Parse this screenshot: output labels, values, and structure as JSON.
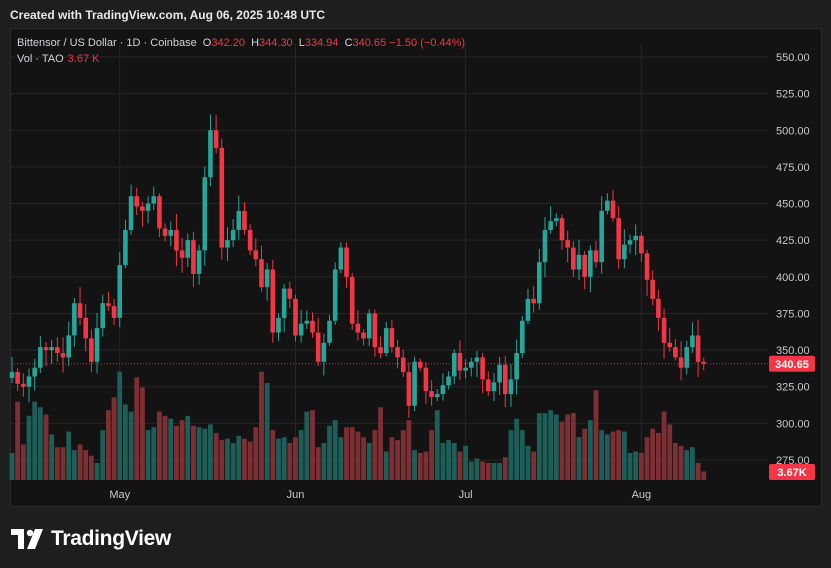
{
  "header": {
    "created_text": "Created with TradingView.com, Aug 06, 2025 10:48 UTC"
  },
  "legend": {
    "symbol": "Bittensor / US Dollar · 1D · Coinbase",
    "open_label": "O",
    "open": "342.20",
    "high_label": "H",
    "high": "344.30",
    "low_label": "L",
    "low": "334.94",
    "close_label": "C",
    "close": "340.65",
    "change": "−1.50 (−0.44%)",
    "volume_label": "Vol · TAO",
    "volume": "3.67 K"
  },
  "price_tag": "340.65",
  "volume_tag": "3.67K",
  "footer": {
    "brand": "TradingView"
  },
  "colors": {
    "up": "#26a69a",
    "down": "#f23645",
    "vol_up": "#1d5f58",
    "vol_down": "#7e2f33",
    "grid": "#262626",
    "axis_text": "#c8c8c8"
  },
  "chart_data": {
    "type": "candlestick",
    "title": "Bittensor / US Dollar · 1D · Coinbase",
    "ylim": [
      265,
      560
    ],
    "y_ticks": [
      550,
      525,
      500,
      475,
      450,
      425,
      400,
      375,
      350,
      325,
      300,
      275
    ],
    "x_tick_labels": [
      {
        "label": "May",
        "date": "2025-05-01"
      },
      {
        "label": "Jun",
        "date": "2025-06-01"
      },
      {
        "label": "Jul",
        "date": "2025-07-01"
      },
      {
        "label": "Aug",
        "date": "2025-08-01"
      }
    ],
    "grid": true,
    "first_date": "2025-04-12",
    "last_price": 340.65,
    "close": [
      335,
      327,
      325,
      332,
      338,
      352,
      350,
      352,
      348,
      345,
      360,
      382,
      372,
      358,
      342,
      365,
      382,
      380,
      372,
      408,
      432,
      455,
      448,
      445,
      450,
      455,
      433,
      428,
      432,
      418,
      413,
      425,
      402,
      418,
      468,
      500,
      488,
      420,
      425,
      432,
      445,
      432,
      418,
      412,
      393,
      405,
      362,
      372,
      392,
      385,
      360,
      368,
      370,
      362,
      342,
      355,
      370,
      405,
      420,
      400,
      368,
      362,
      358,
      375,
      352,
      348,
      365,
      352,
      345,
      335,
      312,
      342,
      338,
      322,
      318,
      320,
      326,
      332,
      348,
      336,
      338,
      342,
      345,
      330,
      322,
      328,
      340,
      320,
      330,
      348,
      370,
      385,
      382,
      410,
      432,
      438,
      440,
      425,
      420,
      405,
      415,
      400,
      418,
      410,
      445,
      452,
      440,
      412,
      422,
      425,
      428,
      416,
      398,
      385,
      372,
      355,
      352,
      345,
      338,
      352,
      360,
      342,
      340.65
    ],
    "volume": [
      1.9,
      5.5,
      2.5,
      4.5,
      5.5,
      5.1,
      4.6,
      3.2,
      2.3,
      2.3,
      3.4,
      2.1,
      2.5,
      2.1,
      1.7,
      1.2,
      3.5,
      4.9,
      5.8,
      7.6,
      5.3,
      4.8,
      7.2,
      6.5,
      3.5,
      3.7,
      4.8,
      4.5,
      4.3,
      3.8,
      4.2,
      4.5,
      3.8,
      3.7,
      3.6,
      3.9,
      3.3,
      2.8,
      2.9,
      2.6,
      3.1,
      2.9,
      2.7,
      3.7,
      7.6,
      6.8,
      3.5,
      2.9,
      3.0,
      2.6,
      3.0,
      3.5,
      4.8,
      4.9,
      2.3,
      2.6,
      3.8,
      4.2,
      3.0,
      3.7,
      3.7,
      3.4,
      3.0,
      2.6,
      3.5,
      5.1,
      2.0,
      3.0,
      2.8,
      3.5,
      4.2,
      2.1,
      1.9,
      2.0,
      3.5,
      4.9,
      2.6,
      2.8,
      2.6,
      2.0,
      2.4,
      1.3,
      1.5,
      1.3,
      1.2,
      1.2,
      1.2,
      1.6,
      3.5,
      4.3,
      3.5,
      2.4,
      2.0,
      4.7,
      4.7,
      4.9,
      4.6,
      4.1,
      4.6,
      4.7,
      3.0,
      3.6,
      4.2,
      6.3,
      3.5,
      3.2,
      3.4,
      3.5,
      3.4,
      1.9,
      2.0,
      1.9,
      3.0,
      3.6,
      3.3,
      4.8,
      3.9,
      2.6,
      2.4,
      2.1,
      2.3,
      1.2,
      0.6
    ]
  }
}
